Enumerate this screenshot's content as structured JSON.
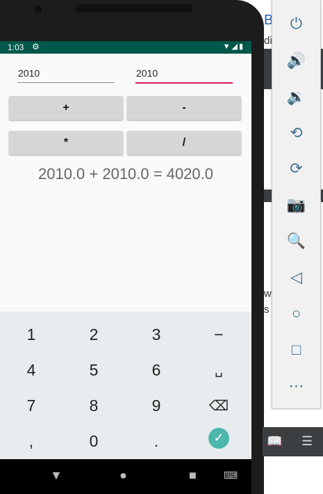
{
  "status_bar": {
    "time": "1:03"
  },
  "inputs": {
    "a_value": "2010",
    "b_value": "2010"
  },
  "buttons": {
    "add": "+",
    "subtract": "-",
    "multiply": "*",
    "divide": "/"
  },
  "result": "2010.0 + 2010.0 = 4020.0",
  "keyboard": {
    "rows": [
      [
        "1",
        "2",
        "3",
        "−"
      ],
      [
        "4",
        "5",
        "6",
        "␣"
      ],
      [
        "7",
        "8",
        "9",
        "⌫"
      ],
      [
        ",",
        "0",
        ".",
        "✓"
      ]
    ]
  },
  "background_window": {
    "text_fragments": [
      "B",
      "di",
      "w",
      "s l"
    ]
  },
  "colors": {
    "status_bar": "#00574b",
    "accent": "#d81b60",
    "done_key": "#4db6ac",
    "toolbar_icon": "#3b6f8f"
  }
}
